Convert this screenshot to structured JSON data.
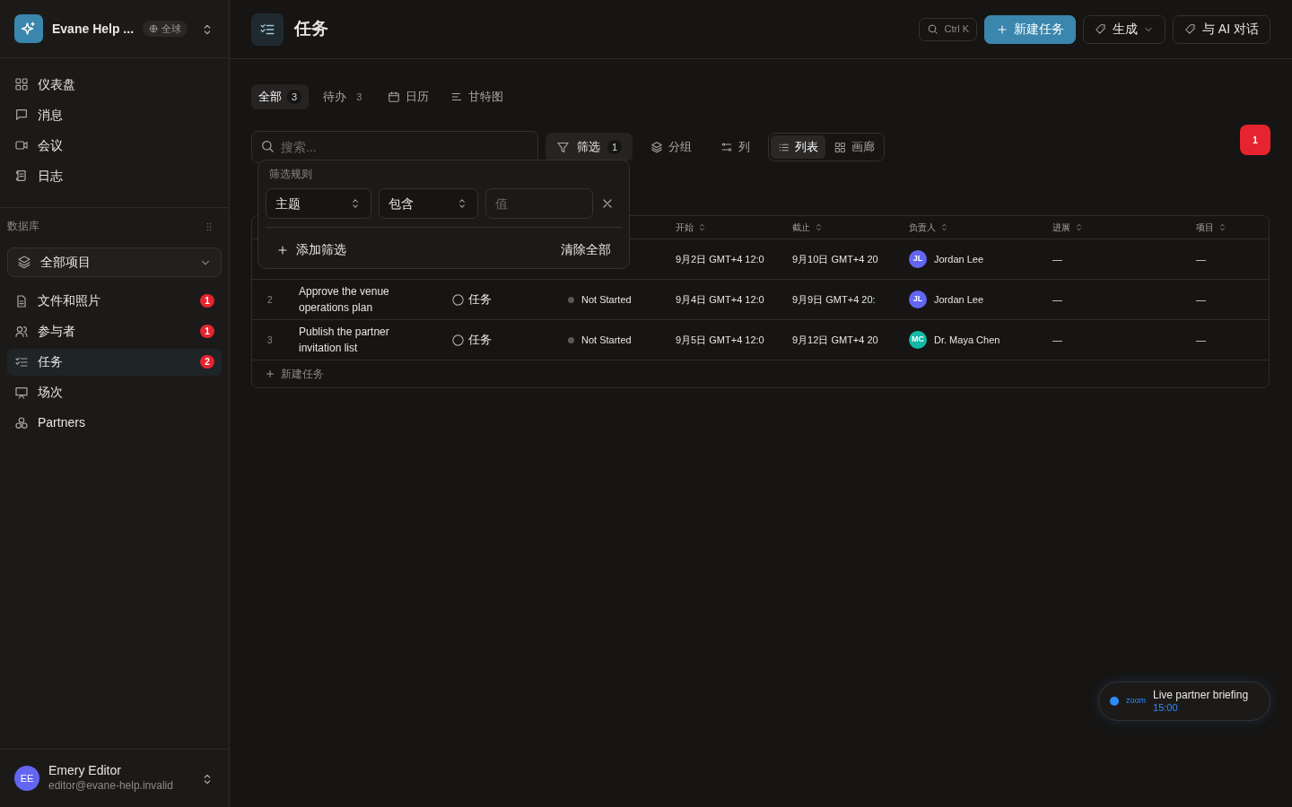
{
  "workspace": {
    "name": "Evane Help ...",
    "scope": "全球"
  },
  "nav": [
    {
      "label": "仪表盘"
    },
    {
      "label": "消息"
    },
    {
      "label": "会议"
    },
    {
      "label": "日志"
    }
  ],
  "database": {
    "title": "数据库",
    "selector": "全部项目",
    "items": [
      {
        "label": "文件和照片",
        "badge": "1",
        "selected": false
      },
      {
        "label": "参与者",
        "badge": "1",
        "selected": false
      },
      {
        "label": "任务",
        "badge": "2",
        "selected": true
      },
      {
        "label": "场次",
        "selected": false
      },
      {
        "label": "Partners",
        "selected": false
      }
    ]
  },
  "user": {
    "initials": "EE",
    "name": "Emery Editor",
    "email": "editor@evane-help.invalid"
  },
  "page": {
    "title": "任务"
  },
  "header_actions": {
    "search_hint": "Ctrl K",
    "new_task": "新建任务",
    "generate": "生成",
    "chat": "与 AI 对话"
  },
  "tabs": [
    {
      "label": "全部",
      "count": "3",
      "selected": true
    },
    {
      "label": "待办",
      "count": "3",
      "selected": false
    },
    {
      "label": "日历",
      "selected": false
    },
    {
      "label": "甘特图",
      "selected": false
    }
  ],
  "toolbar": {
    "search_placeholder": "搜索...",
    "filter": "筛选",
    "filter_count": "1",
    "group": "分组",
    "columns": "列",
    "views": [
      {
        "label": "列表",
        "selected": true
      },
      {
        "label": "画廊",
        "selected": false
      }
    ],
    "alert_count": "1"
  },
  "table": {
    "columns": [
      "开始",
      "截止",
      "负责人",
      "进展",
      "项目"
    ],
    "rows": [
      {
        "start": "9月2日 GMT+4 12:0",
        "due": "9月10日 GMT+4 20",
        "assignee": {
          "initials": "JL",
          "name": "Jordan Lee",
          "color": "#6366f1"
        },
        "progress": "—",
        "project": "—"
      },
      {
        "number": "2",
        "title": "Approve the venue operations plan",
        "type": "任务",
        "status": "Not Started",
        "start": "9月4日 GMT+4 12:0",
        "due": "9月9日 GMT+4 20:",
        "assignee": {
          "initials": "JL",
          "name": "Jordan Lee",
          "color": "#6366f1"
        },
        "progress": "—",
        "project": "—"
      },
      {
        "number": "3",
        "title": "Publish the partner invitation list",
        "type": "任务",
        "status": "Not Started",
        "start": "9月5日 GMT+4 12:0",
        "due": "9月12日 GMT+4 20",
        "assignee": {
          "initials": "MC",
          "name": "Dr. Maya Chen",
          "color": "#14b8a6"
        },
        "progress": "—",
        "project": "—"
      }
    ],
    "add_row": "新建任务"
  },
  "filter_popover": {
    "title": "筛选规则",
    "field": "主题",
    "operator": "包含",
    "value_placeholder": "值",
    "add": "添加筛选",
    "clear": "清除全部"
  },
  "toast": {
    "brand": "zoom",
    "title": "Live partner briefing",
    "time": "15:00"
  }
}
